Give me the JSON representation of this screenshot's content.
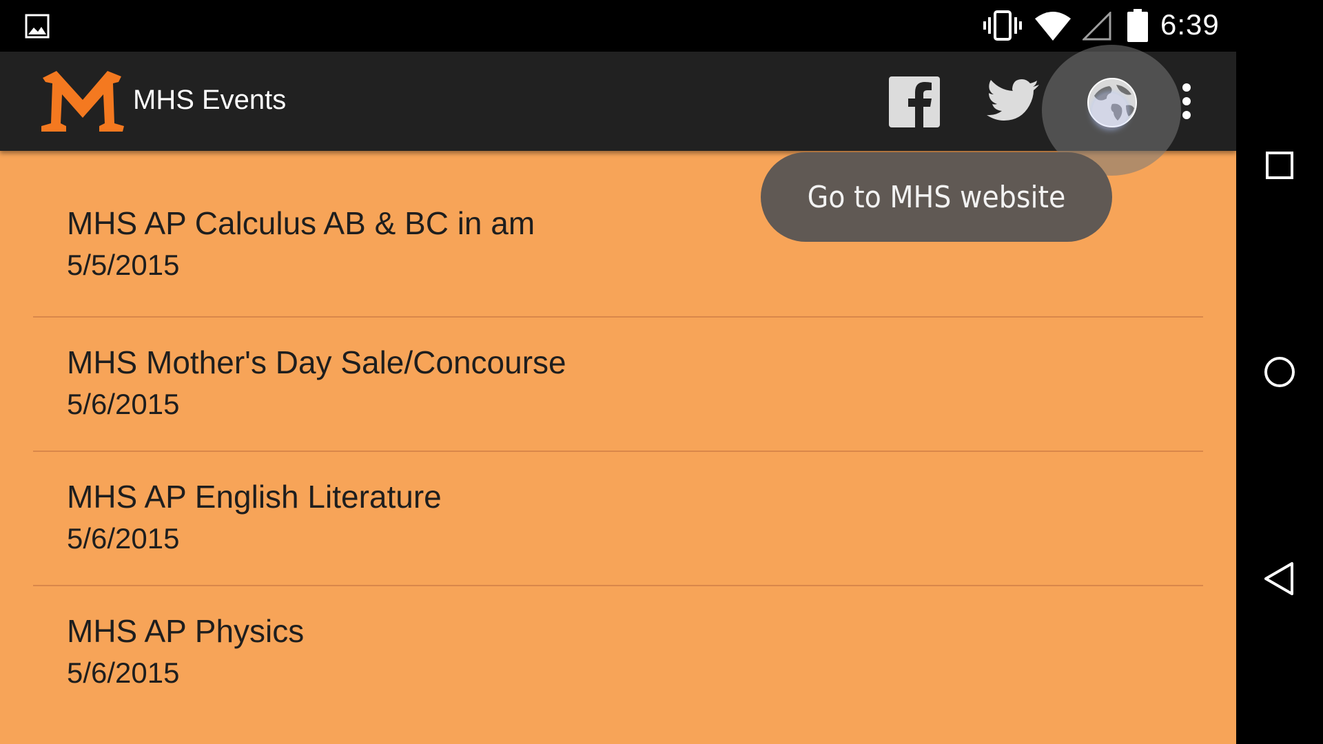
{
  "status_bar": {
    "time": "6:39",
    "icons": [
      "gallery-icon",
      "vibrate-icon",
      "wifi-icon",
      "signal-icon",
      "battery-icon"
    ]
  },
  "app_bar": {
    "title": "MHS Events",
    "logo_letter": "M",
    "logo_color": "#F47920",
    "background": "#212121",
    "actions": [
      "facebook-icon",
      "twitter-icon",
      "globe-icon",
      "overflow-menu-icon"
    ]
  },
  "tooltip": {
    "text": "Go to MHS website"
  },
  "events": [
    {
      "title": "MHS AP Calculus AB & BC in am",
      "date": "5/5/2015"
    },
    {
      "title": "MHS Mother's Day Sale/Concourse",
      "date": "5/6/2015"
    },
    {
      "title": "MHS AP English Literature",
      "date": "5/6/2015"
    },
    {
      "title": "MHS AP Physics",
      "date": "5/6/2015"
    }
  ],
  "colors": {
    "content_background": "#F7A458",
    "divider": "#D9874A",
    "tooltip_background": "#605954"
  },
  "nav_bar": {
    "buttons": [
      "recents-icon",
      "home-icon",
      "back-icon"
    ]
  }
}
